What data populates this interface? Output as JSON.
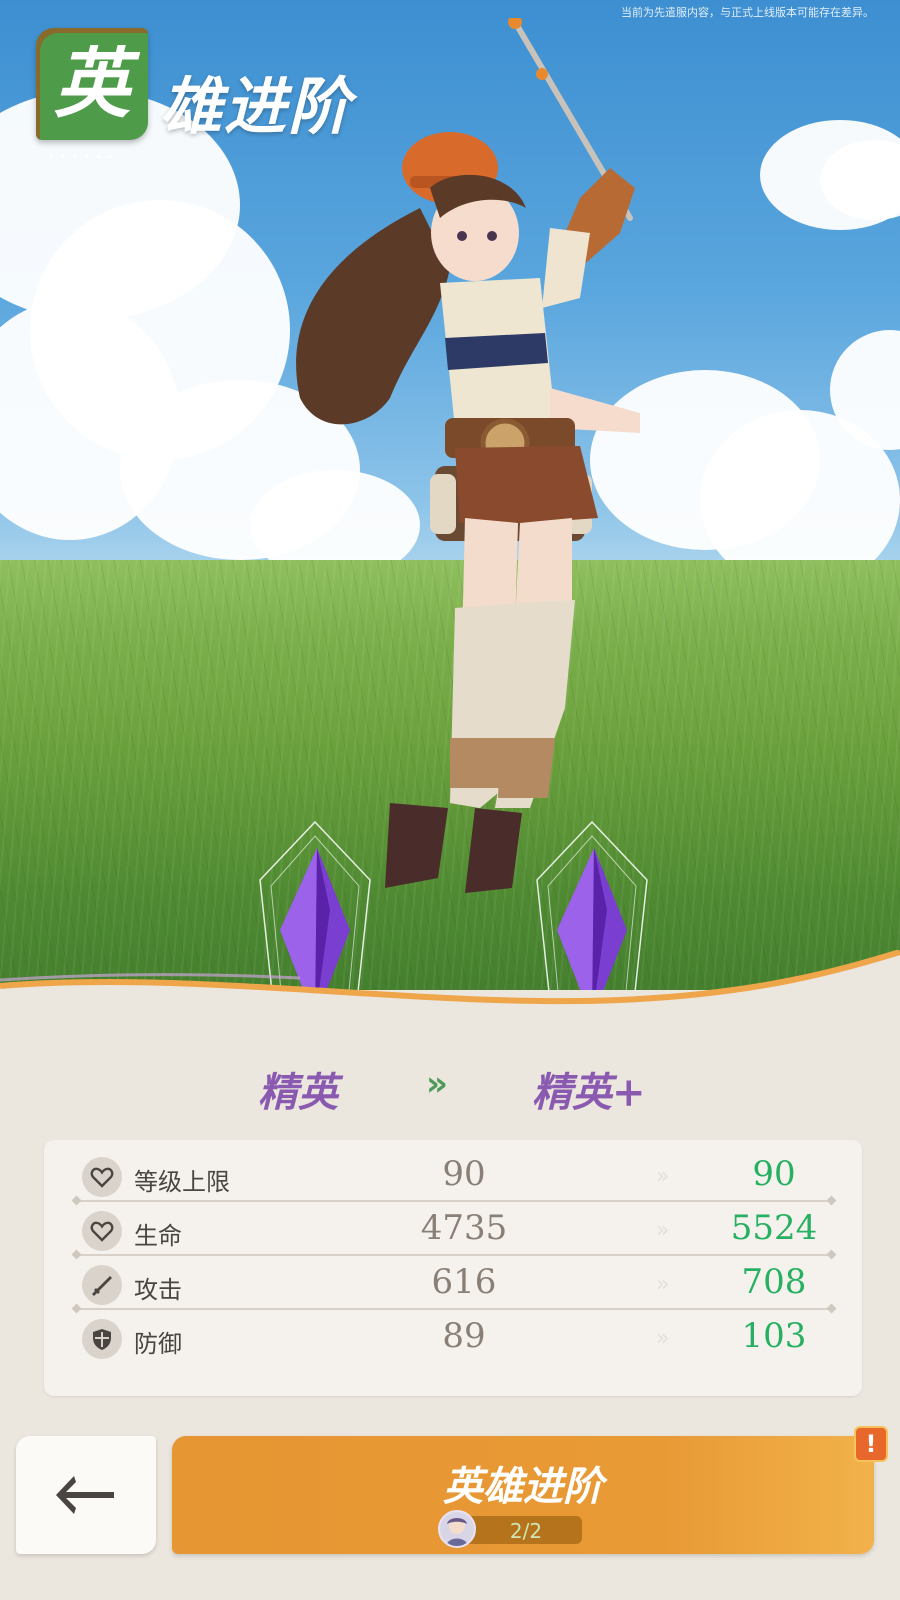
{
  "notice": "当前为先遣服内容，与正式上线版本可能存在差异。",
  "title": {
    "badge_char": "英",
    "rest": "雄进阶",
    "dots": "••••••"
  },
  "ranks": {
    "current": "精英",
    "next": "精英+",
    "arrow": "»"
  },
  "stats": [
    {
      "name": "等级上限",
      "icon": "heart-icon",
      "current": "90",
      "next": "90"
    },
    {
      "name": "生命",
      "icon": "heart-icon",
      "current": "4735",
      "next": "5524"
    },
    {
      "name": "攻击",
      "icon": "sword-icon",
      "current": "616",
      "next": "708"
    },
    {
      "name": "防御",
      "icon": "shield-icon",
      "current": "89",
      "next": "103"
    }
  ],
  "stat_arrow": "»",
  "back": {
    "icon": "back-arrow-icon"
  },
  "advance_button": {
    "label": "英雄进阶",
    "cost": "2/2"
  },
  "alert": "!",
  "colors": {
    "accent": "#e89a35",
    "rank": "#8a5ab0",
    "increase": "#27b061",
    "badge": "#4e9b4a"
  }
}
